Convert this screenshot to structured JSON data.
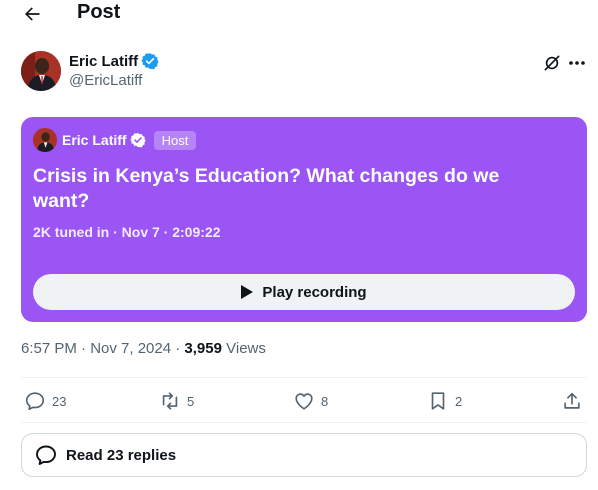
{
  "header": {
    "title": "Post"
  },
  "author": {
    "name": "Eric Latiff",
    "handle": "@EricLatiff"
  },
  "space": {
    "host_name": "Eric Latiff",
    "host_badge": "Host",
    "title": "Crisis in Kenya’s Education? What changes do we want?",
    "meta": "2K tuned in · Nov 7 · 2:09:22",
    "play_label": "Play recording",
    "background_color": "#9a55f4"
  },
  "post_meta": {
    "time": "6:57 PM · Nov 7, 2024 · ",
    "views_count": "3,959",
    "views_label": " Views"
  },
  "actions": {
    "replies": "23",
    "reposts": "5",
    "likes": "8",
    "bookmarks": "2"
  },
  "read_replies": {
    "label": "Read 23 replies"
  },
  "colors": {
    "verified": "#1d9bf0",
    "secondary_text": "#536471"
  }
}
